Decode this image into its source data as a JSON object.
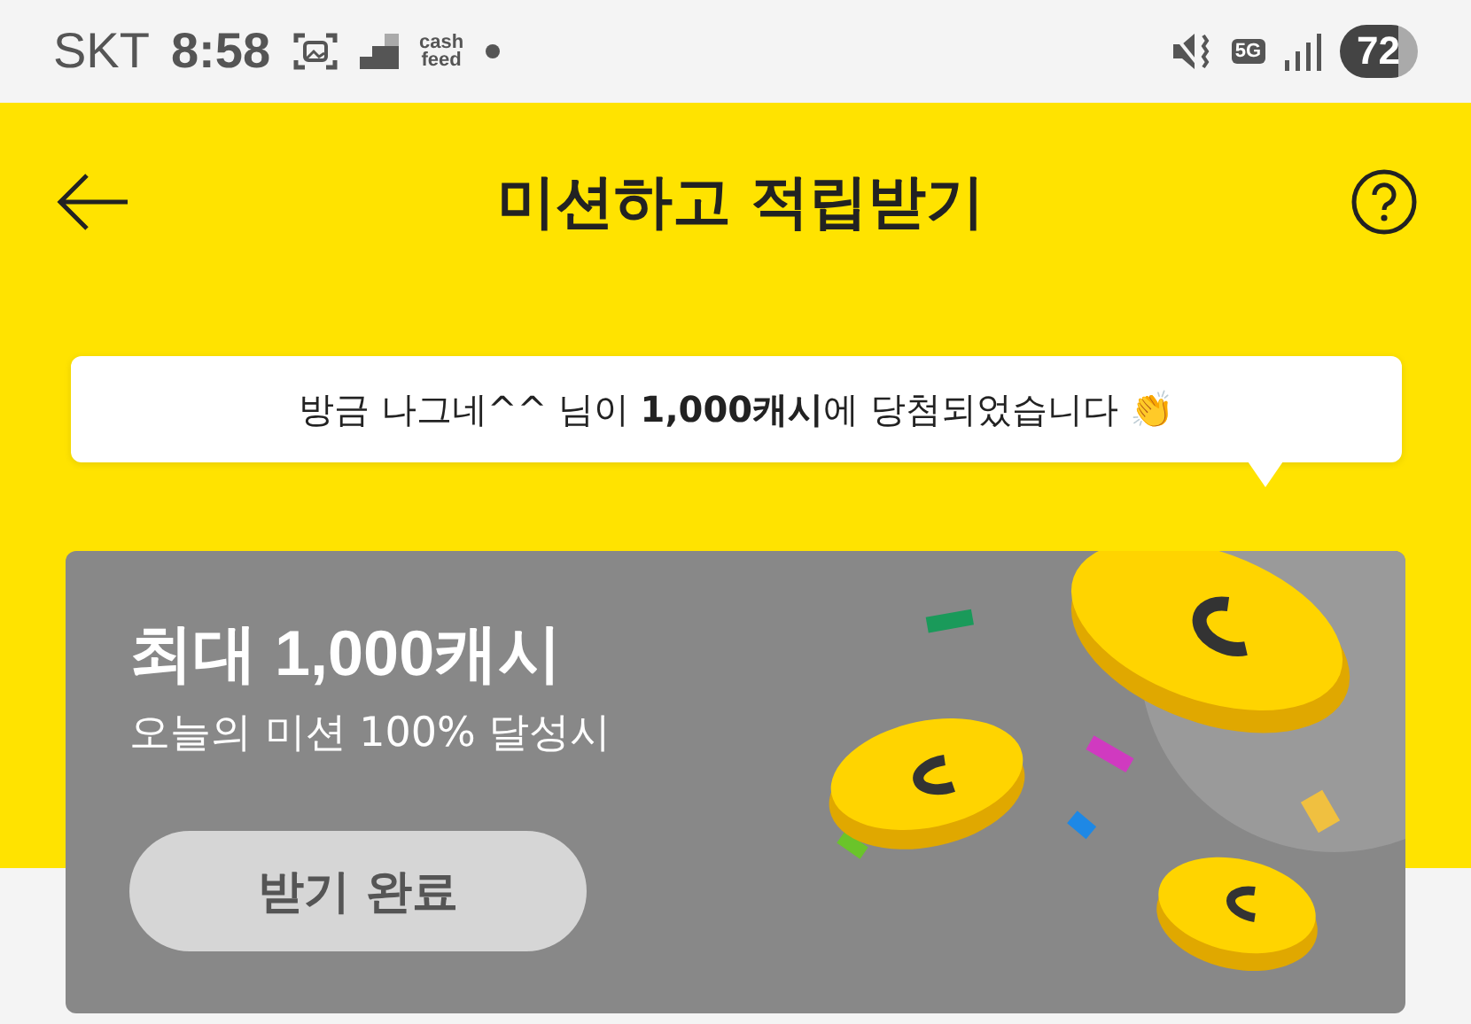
{
  "status_bar": {
    "carrier": "SKT",
    "time": "8:58",
    "app_logo": [
      "cash",
      "feed"
    ],
    "network": "5G",
    "battery": "72"
  },
  "header": {
    "title": "미션하고 적립받기"
  },
  "ticker": {
    "text": "방금 나그네^^ 님이 **1,000캐시**에 당첨되었습니다 👏"
  },
  "reward_card": {
    "title": "최대 1,000캐시",
    "subtitle": "오늘의 미션 100% 달성시",
    "button": {
      "label": "받기 완료",
      "disabled": true
    }
  }
}
